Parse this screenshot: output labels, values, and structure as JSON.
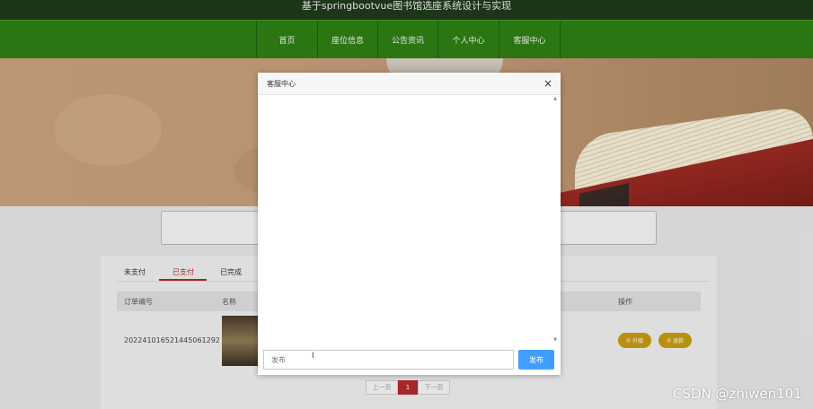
{
  "header": {
    "title": "基于springbootvue图书馆选座系统设计与实现"
  },
  "nav": {
    "items": [
      {
        "label": "首页"
      },
      {
        "label": "座位信息"
      },
      {
        "label": "公告资讯"
      },
      {
        "label": "个人中心"
      },
      {
        "label": "客服中心"
      }
    ]
  },
  "orders": {
    "tabs": [
      {
        "label": "未支付"
      },
      {
        "label": "已支付"
      },
      {
        "label": "已完成"
      }
    ],
    "active_tab": "已支付",
    "columns": {
      "order_no": "订单编号",
      "name": "名称",
      "actions": "操作"
    },
    "rows": [
      {
        "order_no": "20224101652144506129​2",
        "pay": "升级",
        "refund": "退款"
      }
    ],
    "pagination": {
      "prev": "上一页",
      "current": "1",
      "next": "下一页"
    }
  },
  "chat_dialog": {
    "title": "客服中心",
    "close_symbol": "×",
    "input_placeholder": "发布",
    "send_label": "发布",
    "cursor_glyph": "I"
  },
  "watermark": "CSDN @zhiwen101",
  "colors": {
    "nav_green": "#2d7f15",
    "accent_red": "#b02a2a",
    "button_blue": "#409eff",
    "action_gold": "#c49a12"
  }
}
